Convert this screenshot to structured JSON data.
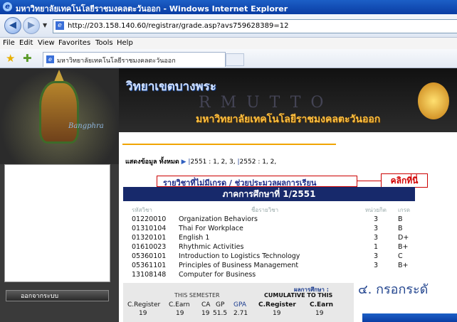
{
  "window": {
    "title": "มหาวิทยาลัยเทคโนโลยีราชมงคลตะวันออก - Windows Internet Explorer"
  },
  "address": {
    "url": "http://203.158.140.60/registrar/grade.asp?avs759628389=12"
  },
  "menu": [
    "File",
    "Edit",
    "View",
    "Favorites",
    "Tools",
    "Help"
  ],
  "tab": {
    "label": "มหาวิทยาลัยเทคโนโลยีราชมงคลตะวันออก"
  },
  "sidebar": {
    "banner": "Bangphra",
    "back": "ออกจากระบบ"
  },
  "header": {
    "title_th": "วิทยาเขตบางพระ",
    "rmutto": "RMUTTO",
    "university_th": "มหาวิทยาลัยเทคโนโลยีราชมงคลตะวันออก"
  },
  "filter": {
    "label": "แสดงข้อมูล ทั้งหมด",
    "y1": "2551",
    "t1": ": 1, 2, 3,",
    "y2": "2552",
    "t2": ": 1, 2,"
  },
  "no_grades": "รายวิชาที่ไม่มีเกรด / ช่วยประมวลผลการเรียน",
  "callout": "คลิกที่นี่",
  "term_title": "ภาคการศึกษาที่ 1/2551",
  "columns": [
    "รหัสวิชา",
    "ชื่อรายวิชา",
    "หน่วยกิต",
    "เกรด"
  ],
  "courses": [
    {
      "code": "01220010",
      "name": "Organization Behaviors",
      "credit": "3",
      "grade": "B"
    },
    {
      "code": "01310104",
      "name": "Thai For Workplace",
      "credit": "3",
      "grade": "B"
    },
    {
      "code": "01320101",
      "name": "English 1",
      "credit": "3",
      "grade": "D+"
    },
    {
      "code": "01610023",
      "name": "Rhythmic Activities",
      "credit": "1",
      "grade": "B+"
    },
    {
      "code": "05360101",
      "name": "Introduction to Logistics Technology",
      "credit": "3",
      "grade": "C"
    },
    {
      "code": "05361101",
      "name": "Principles of Business Management",
      "credit": "3",
      "grade": "B+"
    },
    {
      "code": "13108148",
      "name": "Computer for Business",
      "credit": "",
      "grade": ""
    }
  ],
  "summary": {
    "this_semester": "THIS SEMESTER",
    "result": "ผลการศึกษา :",
    "cumulative": "CUMULATIVE TO THIS",
    "headers": [
      "C.Register",
      "C.Earn",
      "CA",
      "GP",
      "GPA",
      "C.Register",
      "C.Earn"
    ],
    "values": [
      "19",
      "19",
      "19",
      "51.5",
      "2.71",
      "19",
      "19"
    ]
  },
  "overlay_text": "๔. กรอกระดั"
}
